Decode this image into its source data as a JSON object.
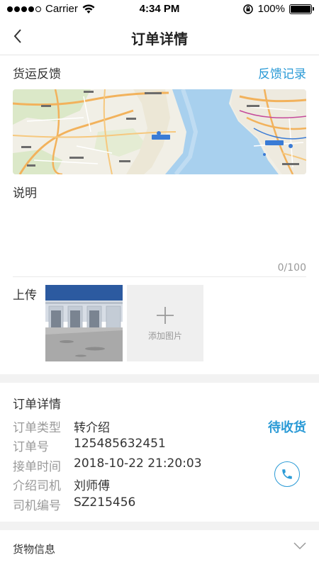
{
  "status_bar": {
    "carrier": "Carrier",
    "time": "4:34 PM",
    "battery": "100%",
    "battery_level": 1.0,
    "icons": [
      "signal-dots",
      "wifi-icon",
      "rotation-lock-icon",
      "battery-icon"
    ]
  },
  "nav": {
    "back_icon": "chevron-left-icon",
    "title": "订单详情"
  },
  "feedback": {
    "title": "货运反馈",
    "record_link": "反馈记录"
  },
  "map": {
    "labels": [
      "福永",
      "珠江口",
      "前海",
      "宝安区",
      "南山区",
      "深圳湾"
    ]
  },
  "description": {
    "label": "说明",
    "placeholder": "",
    "value": "",
    "count": "0/100"
  },
  "upload": {
    "label": "上传",
    "add_text": "添加图片",
    "add_icon": "plus-icon"
  },
  "order_detail": {
    "title": "订单详情",
    "status": "待收货",
    "phone_icon": "phone-icon",
    "rows": [
      {
        "key": "订单类型",
        "value": "转介绍"
      },
      {
        "key": "订单号",
        "value": "125485632451"
      },
      {
        "key": "接单时间",
        "value": "2018-10-22 21:20:03"
      },
      {
        "key": "介绍司机",
        "value": "刘师傅"
      },
      {
        "key": "司机编号",
        "value": "SZ215456"
      }
    ]
  },
  "goods": {
    "label": "货物信息",
    "chevron_icon": "chevron-down-icon"
  },
  "colors": {
    "accent": "#2a9ad6",
    "muted_text": "#999999",
    "divider_bg": "#f2f2f2"
  }
}
